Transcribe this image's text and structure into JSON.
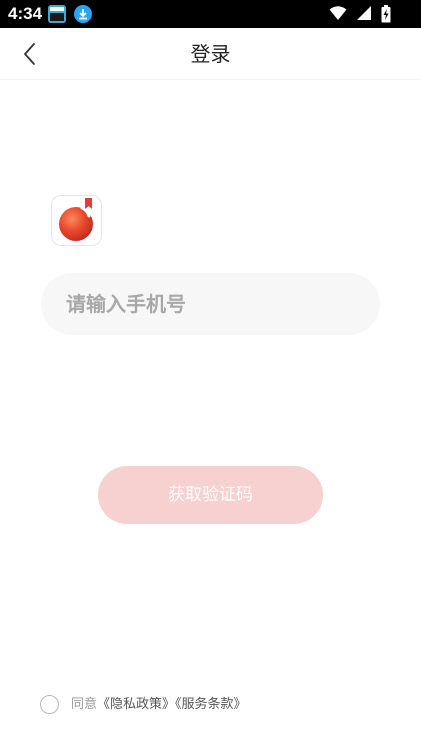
{
  "status_bar": {
    "time": "4:34",
    "icons": [
      "gallery-notification-icon",
      "download-notification-icon",
      "wifi-icon",
      "signal-icon",
      "battery-charging-icon"
    ]
  },
  "header": {
    "title": "登录",
    "back_icon": "chevron-left-icon"
  },
  "logo": {
    "icon": "app-logo-icon",
    "colors": {
      "primary": "#e8452c",
      "bookmark": "#e83a3a"
    }
  },
  "form": {
    "phone_placeholder": "请输入手机号",
    "phone_value": ""
  },
  "actions": {
    "get_code_label": "获取验证码",
    "button_color": "#f7d0d0"
  },
  "agreement": {
    "prefix": "同意",
    "privacy_link": "《隐私政策》",
    "terms_link": "《服务条款》",
    "checked": false
  }
}
